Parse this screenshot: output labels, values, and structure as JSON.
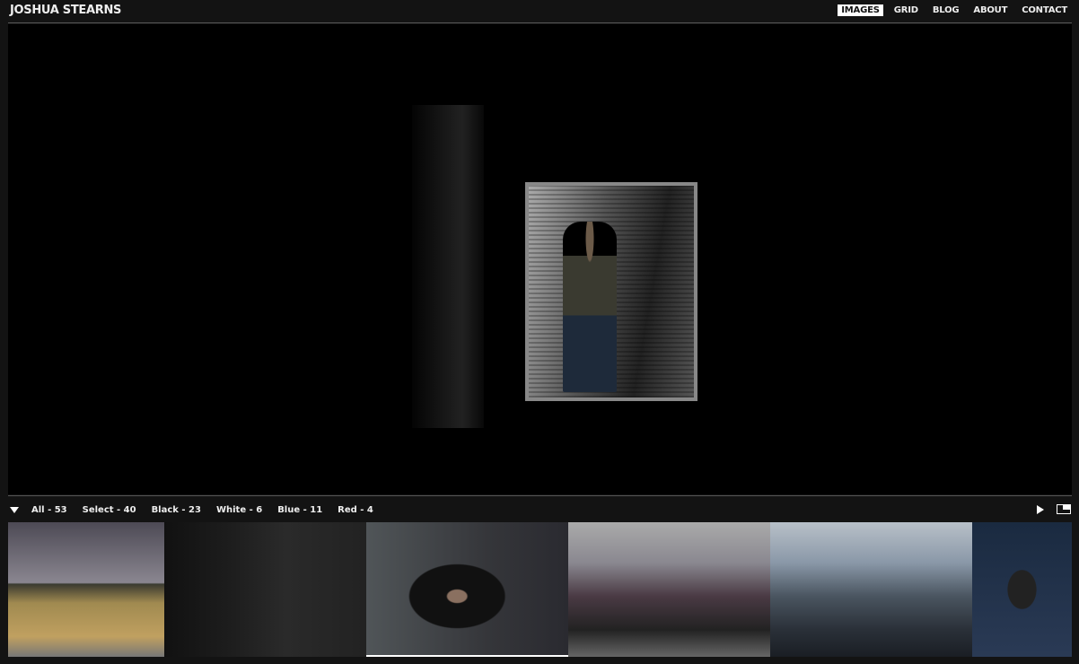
{
  "header": {
    "title": "JOSHUA STEARNS",
    "nav": [
      {
        "label": "IMAGES",
        "active": true
      },
      {
        "label": "GRID"
      },
      {
        "label": "BLOG"
      },
      {
        "label": "ABOUT"
      },
      {
        "label": "CONTACT"
      }
    ]
  },
  "filters": [
    "All - 53",
    "Select - 40",
    "Black - 23",
    "White - 6",
    "Blue - 11",
    "Red - 4"
  ],
  "controls": {
    "play_icon": "play-icon",
    "fullscreen_icon": "fullscreen-icon",
    "toggle_icon": "triangle-down-icon"
  },
  "thumbnails": [
    {
      "name": "desert-field",
      "selected": false
    },
    {
      "name": "night-streetlight",
      "selected": false
    },
    {
      "name": "portrait-wall",
      "selected": true
    },
    {
      "name": "city-towers",
      "selected": false
    },
    {
      "name": "city-skyline-rail",
      "selected": false
    },
    {
      "name": "dancer",
      "selected": false
    }
  ]
}
